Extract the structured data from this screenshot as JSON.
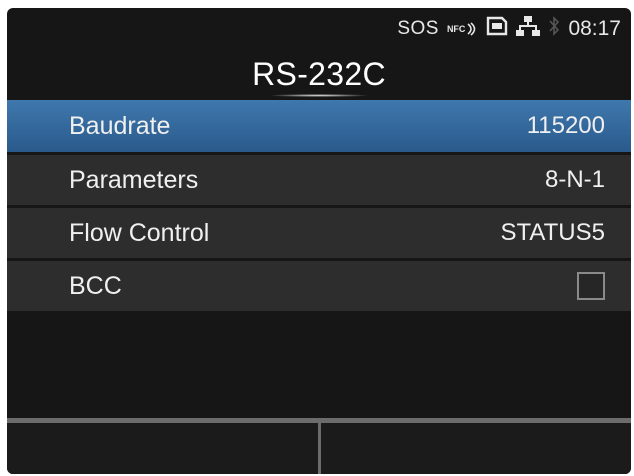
{
  "status_bar": {
    "sos": "SOS",
    "nfc": "NFC",
    "time": "08:17",
    "icons": [
      "nfc-icon",
      "sd-card-icon",
      "lan-icon",
      "bluetooth-icon"
    ]
  },
  "title": "RS-232C",
  "menu": {
    "items": [
      {
        "label": "Baudrate",
        "value": "115200",
        "selected": true
      },
      {
        "label": "Parameters",
        "value": "8-N-1",
        "selected": false
      },
      {
        "label": "Flow Control",
        "value": "STATUS5",
        "selected": false
      },
      {
        "label": "BCC",
        "checked": false,
        "selected": false
      }
    ]
  },
  "colors": {
    "selected_row": "#3a6fa3",
    "row_bg": "#2d2d2d",
    "screen_bg": "#161616"
  }
}
